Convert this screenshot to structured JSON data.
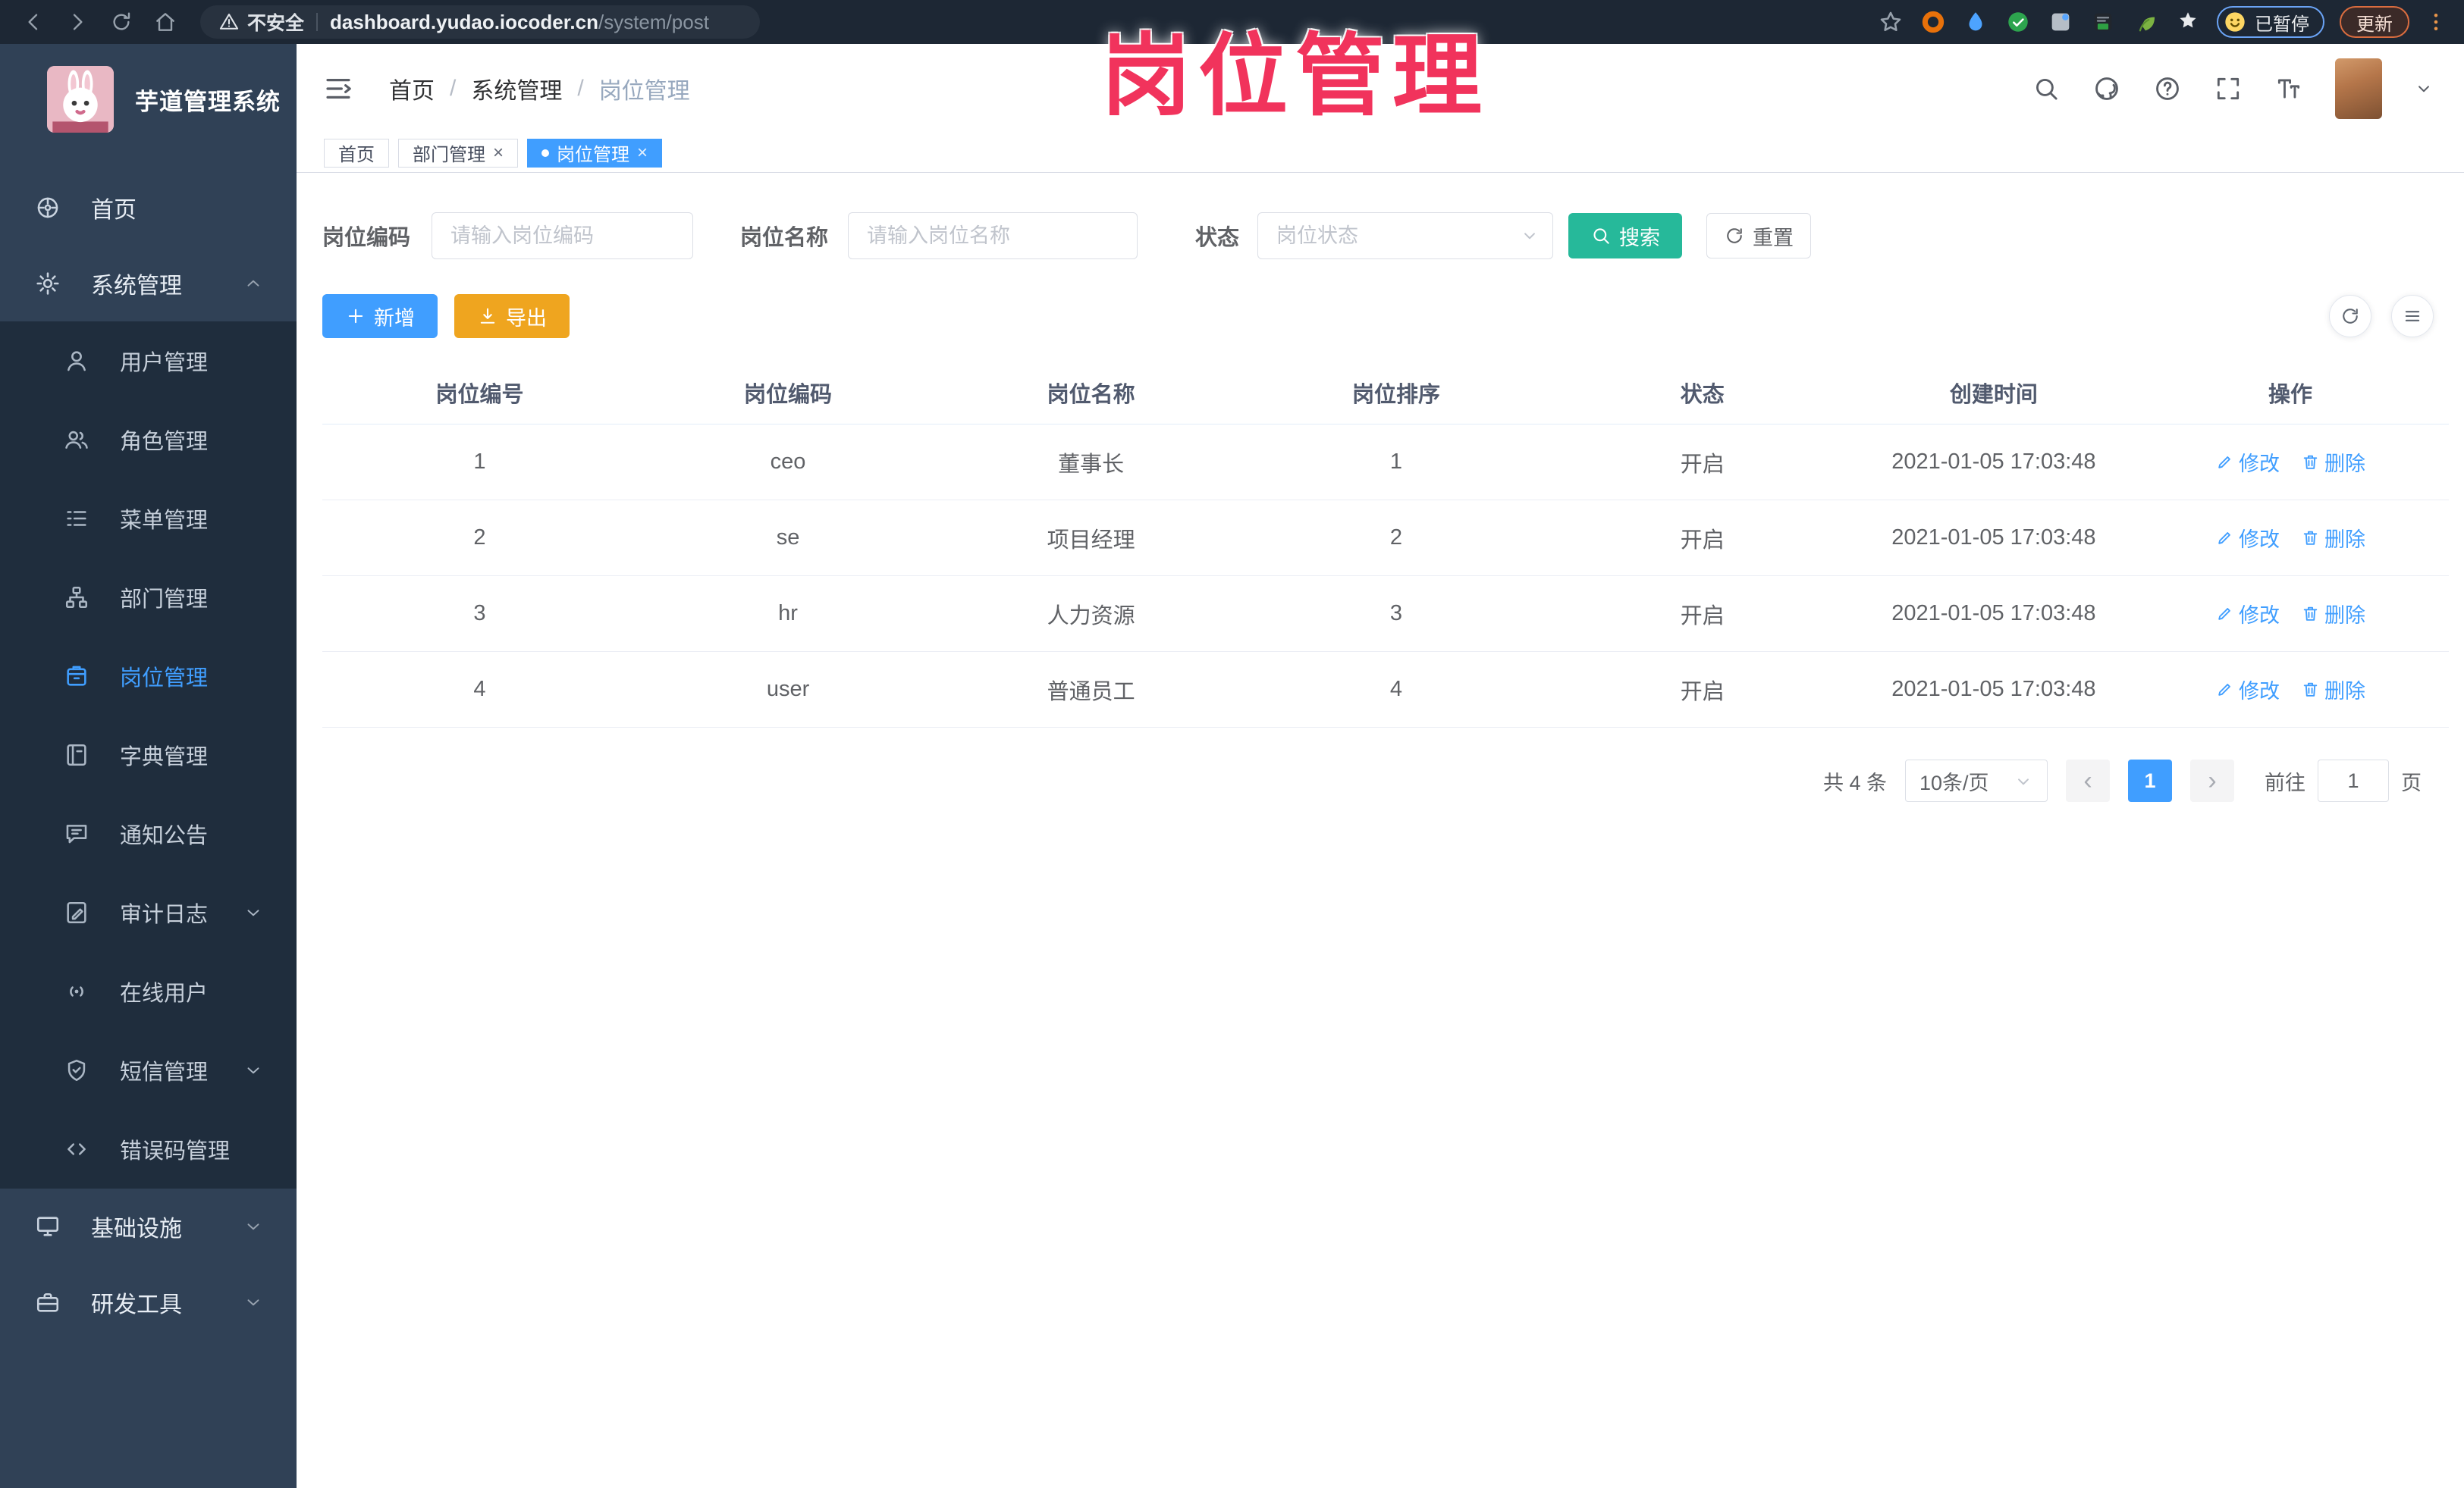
{
  "browser": {
    "security_label": "不安全",
    "url_host": "dashboard.yudao.iocoder.cn",
    "url_path": "/system/post",
    "paused_badge_label": "已暂停",
    "update_button_label": "更新"
  },
  "watermark_text": "岗位管理",
  "sidebar": {
    "logo_title": "芋道管理系统",
    "items": [
      {
        "label": "首页",
        "icon": "dashboard-icon",
        "level": 1
      },
      {
        "label": "系统管理",
        "icon": "gear-icon",
        "level": 1,
        "chevron": "up"
      },
      {
        "label": "用户管理",
        "icon": "user-icon",
        "level": 2
      },
      {
        "label": "角色管理",
        "icon": "users-icon",
        "level": 2
      },
      {
        "label": "菜单管理",
        "icon": "menu-list-icon",
        "level": 2
      },
      {
        "label": "部门管理",
        "icon": "org-tree-icon",
        "level": 2
      },
      {
        "label": "岗位管理",
        "icon": "post-badge-icon",
        "level": 2,
        "active": true
      },
      {
        "label": "字典管理",
        "icon": "dictionary-icon",
        "level": 2
      },
      {
        "label": "通知公告",
        "icon": "announcement-icon",
        "level": 2
      },
      {
        "label": "审计日志",
        "icon": "audit-log-icon",
        "level": 2,
        "chevron": "down"
      },
      {
        "label": "在线用户",
        "icon": "online-user-icon",
        "level": 2
      },
      {
        "label": "短信管理",
        "icon": "sms-shield-icon",
        "level": 2,
        "chevron": "down"
      },
      {
        "label": "错误码管理",
        "icon": "error-code-icon",
        "level": 2
      },
      {
        "label": "基础设施",
        "icon": "infrastructure-icon",
        "level": 1,
        "chevron": "down"
      },
      {
        "label": "研发工具",
        "icon": "dev-tools-icon",
        "level": 1,
        "chevron": "down"
      }
    ]
  },
  "header": {
    "breadcrumb": [
      "首页",
      "系统管理",
      "岗位管理"
    ]
  },
  "tabs": [
    {
      "label": "首页",
      "active": false,
      "closable": false
    },
    {
      "label": "部门管理",
      "active": false,
      "closable": true
    },
    {
      "label": "岗位管理",
      "active": true,
      "closable": true
    }
  ],
  "filters": {
    "post_code_label": "岗位编码",
    "post_code_placeholder": "请输入岗位编码",
    "post_name_label": "岗位名称",
    "post_name_placeholder": "请输入岗位名称",
    "status_label": "状态",
    "status_placeholder": "岗位状态",
    "search_label": "搜索",
    "reset_label": "重置"
  },
  "toolbar": {
    "add_label": "新增",
    "export_label": "导出"
  },
  "table": {
    "headers": [
      "岗位编号",
      "岗位编码",
      "岗位名称",
      "岗位排序",
      "状态",
      "创建时间",
      "操作"
    ],
    "rows": [
      {
        "id": "1",
        "code": "ceo",
        "name": "董事长",
        "sort": "1",
        "status": "开启",
        "created": "2021-01-05 17:03:48"
      },
      {
        "id": "2",
        "code": "se",
        "name": "项目经理",
        "sort": "2",
        "status": "开启",
        "created": "2021-01-05 17:03:48"
      },
      {
        "id": "3",
        "code": "hr",
        "name": "人力资源",
        "sort": "3",
        "status": "开启",
        "created": "2021-01-05 17:03:48"
      },
      {
        "id": "4",
        "code": "user",
        "name": "普通员工",
        "sort": "4",
        "status": "开启",
        "created": "2021-01-05 17:03:48"
      }
    ],
    "edit_label": "修改",
    "delete_label": "删除"
  },
  "pagination": {
    "total_label": "共 4 条",
    "page_size_label": "10条/页",
    "prev_glyph": "‹",
    "current_page": "1",
    "next_glyph": "›",
    "goto_label": "前往",
    "goto_value": "1",
    "page_unit_label": "页"
  },
  "ui": {
    "close_glyph": "×",
    "breadcrumb_sep": "/"
  },
  "colors": {
    "accent_blue": "#409eff",
    "search_teal": "#26b99a",
    "export_orange": "#efa51f",
    "sidebar_bg": "#304156",
    "submenu_bg": "#1f2d3d",
    "watermark_red": "#f1335c",
    "browser_bar_bg": "#1d2734"
  }
}
